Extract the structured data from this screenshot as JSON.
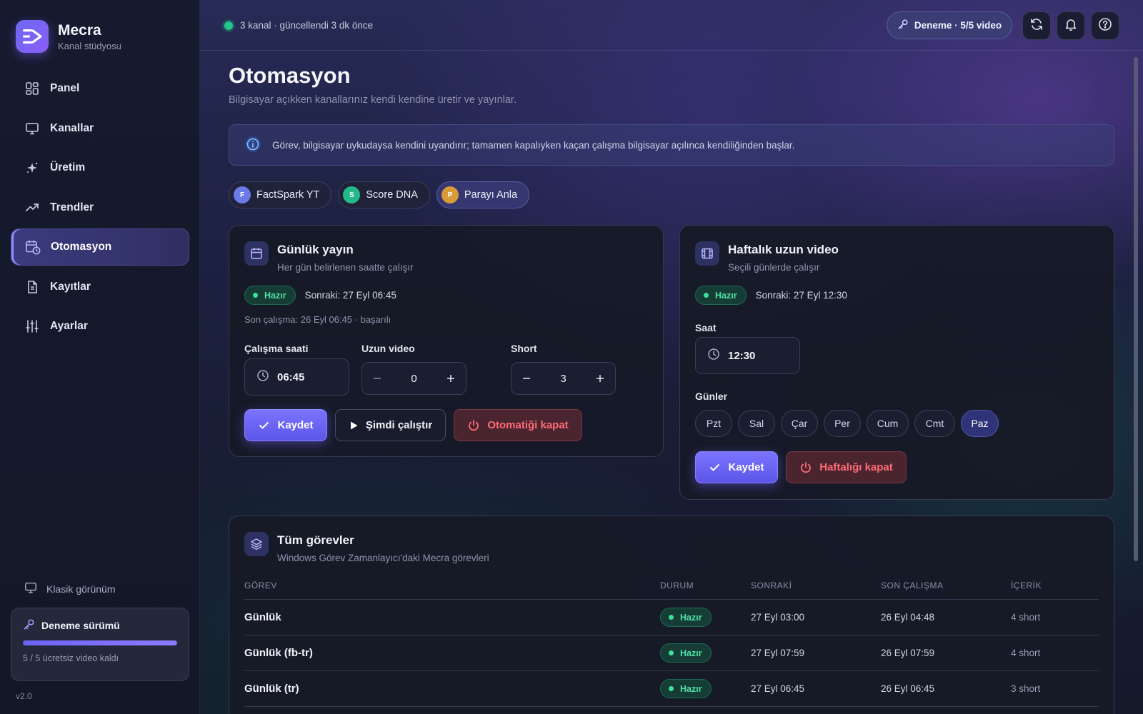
{
  "brand": {
    "name": "Mecra",
    "subtitle": "Kanal stüdyosu"
  },
  "nav": {
    "items": [
      {
        "label": "Panel",
        "icon": "grid-icon"
      },
      {
        "label": "Kanallar",
        "icon": "monitor-icon"
      },
      {
        "label": "Üretim",
        "icon": "sparkle-icon"
      },
      {
        "label": "Trendler",
        "icon": "trend-icon"
      },
      {
        "label": "Otomasyon",
        "icon": "calendar-clock-icon",
        "active": true
      },
      {
        "label": "Kayıtlar",
        "icon": "document-icon"
      },
      {
        "label": "Ayarlar",
        "icon": "sliders-icon"
      }
    ]
  },
  "sidebar_footer": {
    "classic_view": "Klasik görünüm",
    "trial_title": "Deneme sürümü",
    "trial_progress": 1.0,
    "trial_note": "5 / 5 ücretsiz video kaldı",
    "version": "v2.0"
  },
  "topbar": {
    "status": "3 kanal · güncellendi 3 dk önce",
    "trial_pill": "Deneme · 5/5 video",
    "icons": [
      "refresh-icon",
      "bell-icon",
      "help-icon"
    ]
  },
  "page": {
    "title": "Otomasyon",
    "subtitle": "Bilgisayar açıkken kanallarınız kendi kendine üretir ve yayınlar.",
    "info": "Görev, bilgisayar uykudaysa kendini uyandırır; tamamen kapalıyken kaçan çalışma bilgisayar açılınca kendiliğinden başlar."
  },
  "channels": [
    {
      "initial": "F",
      "name": "FactSpark YT",
      "color": "#6a7be8"
    },
    {
      "initial": "S",
      "name": "Score DNA",
      "color": "#24b88a"
    },
    {
      "initial": "P",
      "name": "Parayı Anla",
      "color": "#d99a3a",
      "active": true
    }
  ],
  "daily": {
    "title": "Günlük yayın",
    "subtitle": "Her gün belirlenen saatte çalışır",
    "badge": "Hazır",
    "next": "Sonraki: 27 Eyl 06:45",
    "last_run": "Son çalışma: 26 Eyl 06:45 · başarılı",
    "time_label": "Çalışma saati",
    "time_value": "06:45",
    "long_label": "Uzun video",
    "long_value": "0",
    "short_label": "Short",
    "short_value": "3",
    "save": "Kaydet",
    "run_now": "Şimdi çalıştır",
    "disable": "Otomatiği kapat"
  },
  "weekly": {
    "title": "Haftalık uzun video",
    "subtitle": "Seçili günlerde çalışır",
    "badge": "Hazır",
    "next": "Sonraki: 27 Eyl 12:30",
    "time_label": "Saat",
    "time_value": "12:30",
    "days_label": "Günler",
    "days": [
      {
        "label": "Pzt"
      },
      {
        "label": "Sal"
      },
      {
        "label": "Çar"
      },
      {
        "label": "Per"
      },
      {
        "label": "Cum"
      },
      {
        "label": "Cmt"
      },
      {
        "label": "Paz",
        "active": true
      }
    ],
    "save": "Kaydet",
    "disable": "Haftalığı kapat"
  },
  "tasks": {
    "title": "Tüm görevler",
    "subtitle": "Windows Görev Zamanlayıcı'daki Mecra görevleri",
    "headers": [
      "GÖREV",
      "DURUM",
      "SONRAKİ",
      "SON ÇALIŞMA",
      "İÇERİK"
    ],
    "rows": [
      {
        "name": "Günlük",
        "status": "Hazır",
        "next": "27 Eyl 03:00",
        "last": "26 Eyl 04:48",
        "content": "4 short"
      },
      {
        "name": "Günlük (fb-tr)",
        "status": "Hazır",
        "next": "27 Eyl 07:59",
        "last": "26 Eyl 07:59",
        "content": "4 short"
      },
      {
        "name": "Günlük (tr)",
        "status": "Hazır",
        "next": "27 Eyl 06:45",
        "last": "26 Eyl 06:45",
        "content": "3 short"
      }
    ]
  },
  "colors": {
    "accent": "#6c64f4",
    "success": "#3ee09a",
    "danger": "#ff6b75"
  }
}
